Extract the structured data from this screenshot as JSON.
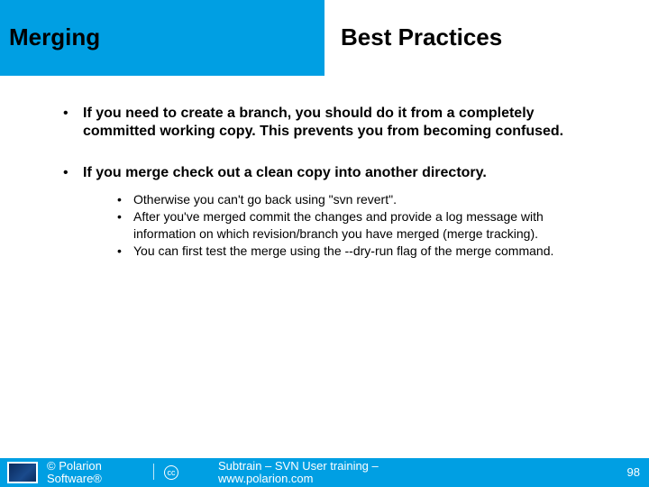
{
  "header": {
    "title_left": "Merging",
    "title_right": "Best Practices"
  },
  "content": {
    "bullets": [
      {
        "text": "If you need to create a branch, you should do it from a completely committed working copy. This prevents you from becoming confused.",
        "children": []
      },
      {
        "text": "If you merge check out a clean copy into another directory.",
        "children": [
          "Otherwise you can't go back using \"svn revert\".",
          "After you've merged commit the changes and provide a log message with information on which revision/branch you have merged (merge tracking).",
          "You can first test the merge using the --dry-run flag of the merge command."
        ]
      }
    ]
  },
  "footer": {
    "copyright_line1": "© Polarion",
    "copyright_line2": "Software®",
    "cc_label": "cc",
    "subtrain_line1": "Subtrain – SVN User training –",
    "subtrain_line2": "www.polarion.com",
    "page_number": "98"
  }
}
